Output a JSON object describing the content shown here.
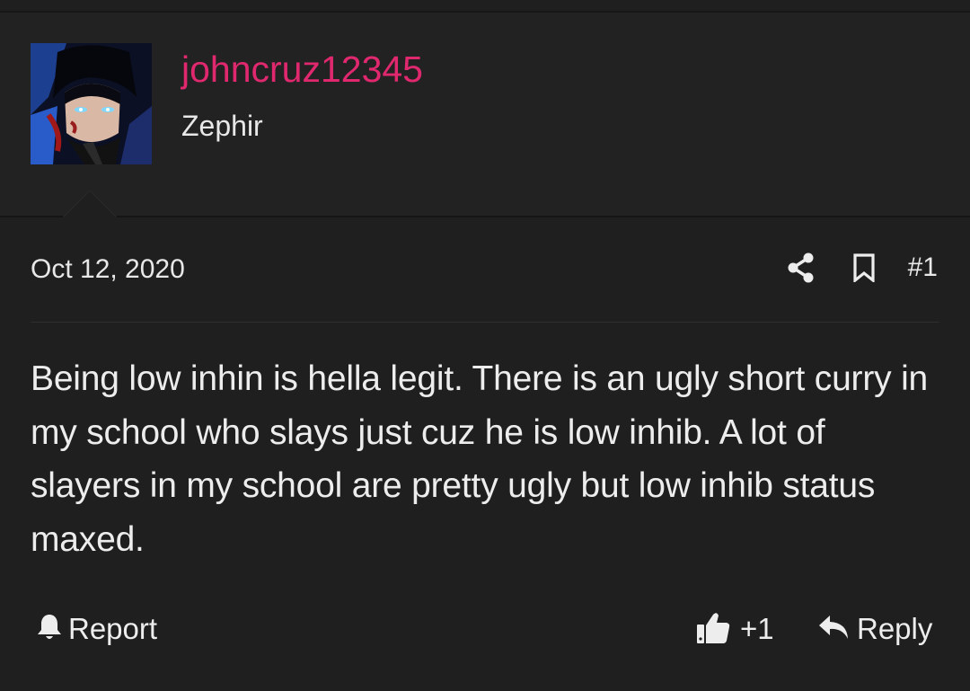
{
  "post": {
    "user": {
      "username": "johncruz12345",
      "title": "Zephir",
      "avatar_icon": "anime-avatar-image",
      "username_color": "#e0286f"
    },
    "date": "Oct 12, 2020",
    "number": "#1",
    "body": "Being low inhin is hella legit. There is an ugly short curry in my school who slays just cuz he is low inhib. A lot of slayers in my school are pretty ugly but low inhib status maxed.",
    "actions": {
      "share_icon": "share-icon",
      "bookmark_icon": "bookmark-icon",
      "report_label": "Report",
      "like_count": "+1",
      "reply_label": "Reply"
    }
  }
}
